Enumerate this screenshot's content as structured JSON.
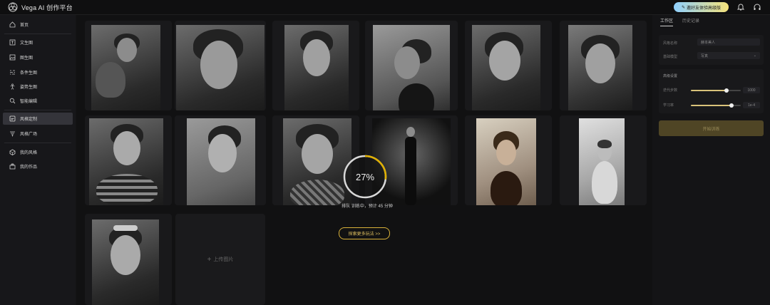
{
  "header": {
    "app_title": "Vega AI 创作平台",
    "invite_label": "邀好友体验高级版"
  },
  "sidebar": {
    "items": [
      {
        "label": "首页",
        "icon": "home-icon"
      },
      {
        "label": "文生图",
        "icon": "text-image-icon"
      },
      {
        "label": "图生图",
        "icon": "image-image-icon"
      },
      {
        "label": "条件生图",
        "icon": "condition-icon"
      },
      {
        "label": "姿势生图",
        "icon": "pose-icon"
      },
      {
        "label": "智能编辑",
        "icon": "edit-icon"
      },
      {
        "label": "风格定制",
        "icon": "style-custom-icon"
      },
      {
        "label": "风格广场",
        "icon": "style-square-icon"
      },
      {
        "label": "我的风格",
        "icon": "my-style-icon"
      },
      {
        "label": "我的作品",
        "icon": "my-works-icon"
      }
    ],
    "active_index": 6
  },
  "main": {
    "progress_value": 27,
    "progress_label": "27%",
    "queue_text": "排队 训练中，预计 45 分钟",
    "explore_label": "探索更多玩法 >>",
    "upload_label": "上传图片"
  },
  "right_panel": {
    "tabs": [
      "工作区",
      "历史记录"
    ],
    "fields": [
      {
        "label": "风格名称",
        "value": "赫本美人"
      },
      {
        "label": "基础模型",
        "value": "写真"
      }
    ],
    "advanced_title": "高级设置",
    "sliders": [
      {
        "label": "迭代步数",
        "value": "1000",
        "fraction": 0.72
      },
      {
        "label": "学习率",
        "value": "1e-4",
        "fraction": 0.82
      }
    ],
    "train_button": "开始训练"
  },
  "colors": {
    "accent_gold": "#d9b13a",
    "active_nav": "#34343a",
    "background": "#111112"
  }
}
